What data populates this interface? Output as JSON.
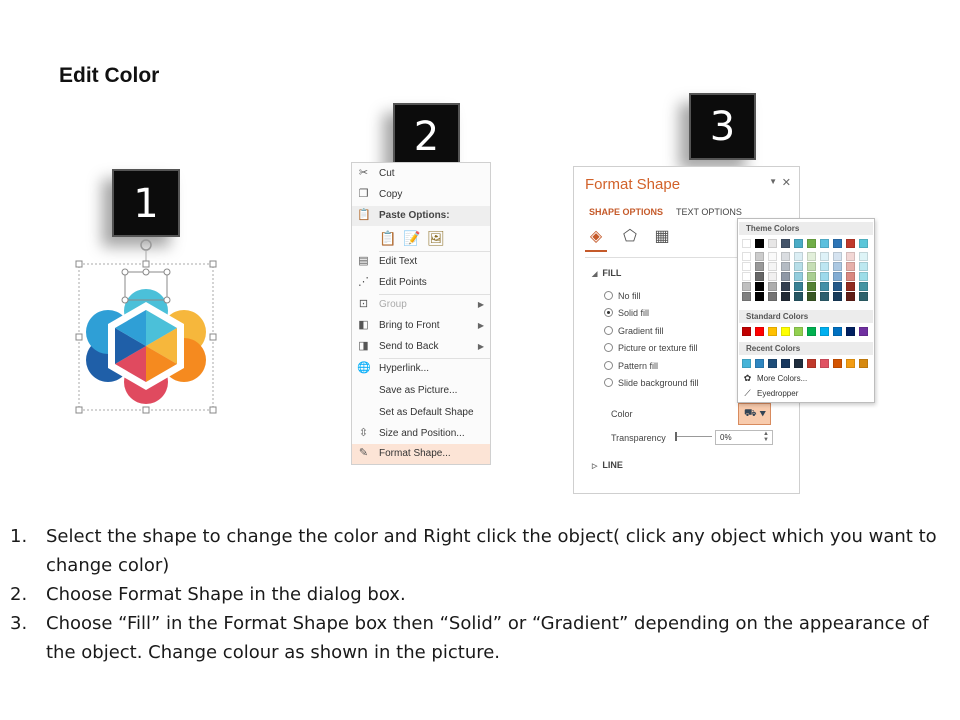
{
  "title": "Edit Color",
  "steps": [
    "1",
    "2",
    "3"
  ],
  "context_menu": {
    "items": [
      {
        "label": "Cut",
        "icon": "scissors-icon"
      },
      {
        "label": "Copy",
        "icon": "copy-icon"
      },
      {
        "label": "Paste Options:",
        "icon": "paste-icon"
      },
      {
        "label": "Edit Text",
        "icon": "edit-text-icon"
      },
      {
        "label": "Edit Points",
        "icon": "edit-points-icon"
      },
      {
        "label": "Group",
        "icon": "group-icon"
      },
      {
        "label": "Bring to Front",
        "icon": "bring-front-icon"
      },
      {
        "label": "Send to Back",
        "icon": "send-back-icon"
      },
      {
        "label": "Hyperlink...",
        "icon": "hyperlink-icon"
      },
      {
        "label": "Save as Picture...",
        "icon": ""
      },
      {
        "label": "Set as Default Shape",
        "icon": ""
      },
      {
        "label": "Size and Position...",
        "icon": "size-position-icon"
      },
      {
        "label": "Format Shape...",
        "icon": "format-shape-icon"
      }
    ]
  },
  "format_pane": {
    "title": "Format Shape",
    "tabs": [
      "SHAPE OPTIONS",
      "TEXT OPTIONS"
    ],
    "fill_section": "FILL",
    "fill_options": [
      "No fill",
      "Solid fill",
      "Gradient fill",
      "Picture or texture fill",
      "Pattern fill",
      "Slide background fill"
    ],
    "selected_fill": "Solid fill",
    "color_label": "Color",
    "transparency_label": "Transparency",
    "transparency_value": "0%",
    "line_section": "LINE"
  },
  "palette": {
    "theme_colors_label": "Theme Colors",
    "standard_colors_label": "Standard Colors",
    "recent_colors_label": "Recent Colors",
    "more_colors": "More Colors...",
    "eyedropper": "Eyedropper",
    "theme_top": [
      "#ffffff",
      "#000000",
      "#e7e6e6",
      "#44546a",
      "#4bacc6",
      "#70ad47",
      "#5bc0de",
      "#2e75b6",
      "#c0392b",
      "#5bc6d9"
    ],
    "standard": [
      "#c00000",
      "#ff0000",
      "#ffc000",
      "#ffff00",
      "#92d050",
      "#00b050",
      "#00b0f0",
      "#0070c0",
      "#002060",
      "#7030a0"
    ],
    "recent": [
      "#46b4d8",
      "#2e86c1",
      "#1f4e79",
      "#17375e",
      "#1f2d3d",
      "#c0392b",
      "#e05263",
      "#d35400",
      "#f39c12",
      "#d68910"
    ]
  },
  "instructions": [
    {
      "num": "1.",
      "text": "Select the shape to change the color and Right click the object( click any object which you want to change color)"
    },
    {
      "num": "2.",
      "text": "Choose Format Shape in the dialog box."
    },
    {
      "num": "3.",
      "text": "Choose “Fill” in the Format Shape box then “Solid” or “Gradient” depending on the appearance of the object. Change colour as shown in the picture."
    }
  ]
}
